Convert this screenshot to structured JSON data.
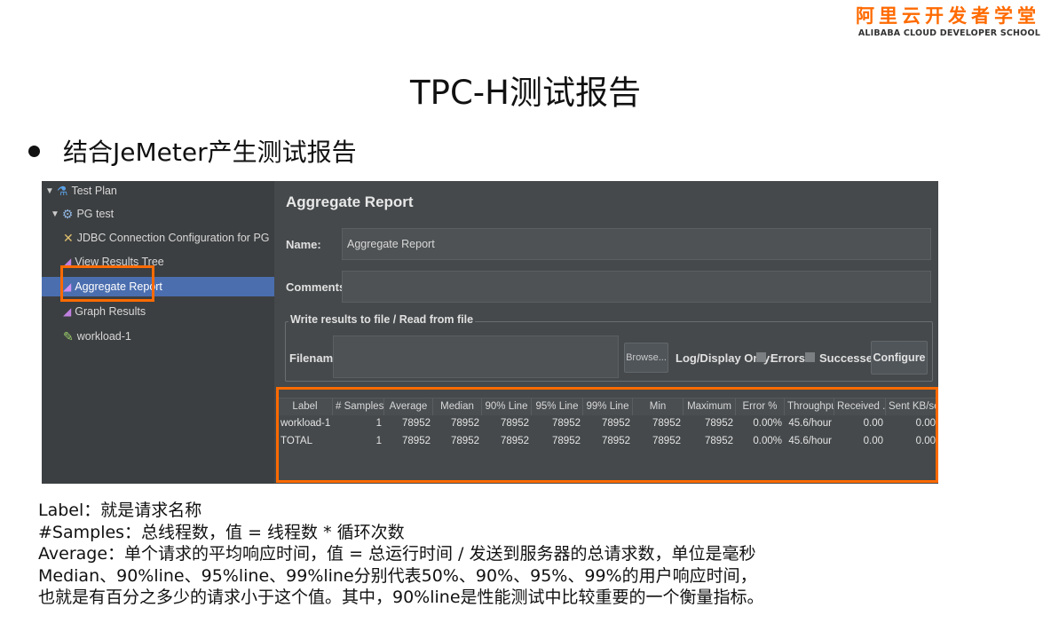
{
  "brand": {
    "cn": "阿里云开发者学堂",
    "en": "ALIBABA CLOUD DEVELOPER SCHOOL"
  },
  "slide": {
    "title": "TPC-H测试报告",
    "bullet": "结合JeMeter产生测试报告"
  },
  "tree": [
    {
      "label": "Test Plan",
      "icon": "flask-icon"
    },
    {
      "label": "PG test",
      "icon": "gear-icon"
    },
    {
      "label": "JDBC Connection Configuration for PG",
      "icon": "wrench-icon"
    },
    {
      "label": "View Results Tree",
      "icon": "report-icon"
    },
    {
      "label": "Aggregate Report",
      "icon": "report-icon",
      "selected": true
    },
    {
      "label": "Graph Results",
      "icon": "graph-icon"
    },
    {
      "label": "workload-1",
      "icon": "pencil-icon"
    }
  ],
  "panel": {
    "title": "Aggregate Report",
    "name_label": "Name:",
    "name_value": "Aggregate Report",
    "comments_label": "Comments:",
    "comments_value": "",
    "file_group_title": "Write results to file / Read from file",
    "filename_label": "Filename",
    "filename_value": "",
    "browse_label": "Browse...",
    "log_display_label": "Log/Display Only:",
    "errors_label": "Errors",
    "successes_label": "Successes",
    "configure_label": "Configure"
  },
  "table": {
    "headers": [
      "Label",
      "# Samples",
      "Average",
      "Median",
      "90% Line",
      "95% Line",
      "99% Line",
      "Min",
      "Maximum",
      "Error %",
      "Throughput",
      "Received ...",
      "Sent KB/sec"
    ],
    "rows": [
      [
        "workload-1",
        "1",
        "78952",
        "78952",
        "78952",
        "78952",
        "78952",
        "78952",
        "78952",
        "0.00%",
        "45.6/hour",
        "0.00",
        "0.00"
      ],
      [
        "TOTAL",
        "1",
        "78952",
        "78952",
        "78952",
        "78952",
        "78952",
        "78952",
        "78952",
        "0.00%",
        "45.6/hour",
        "0.00",
        "0.00"
      ]
    ]
  },
  "notes": [
    "Label：就是请求名称",
    "#Samples：总线程数，值 = 线程数 * 循环次数",
    "Average：单个请求的平均响应时间，值 = 总运行时间 / 发送到服务器的总请求数，单位是毫秒",
    "Median、90%line、95%line、99%line分别代表50%、90%、95%、99%的用户响应时间，",
    "也就是有百分之多少的请求小于这个值。其中，90%line是性能测试中比较重要的一个衡量指标。"
  ],
  "colors": {
    "brand": "#ff6a00",
    "highlight": "#ff6a00",
    "selection": "#4b6eaf"
  }
}
